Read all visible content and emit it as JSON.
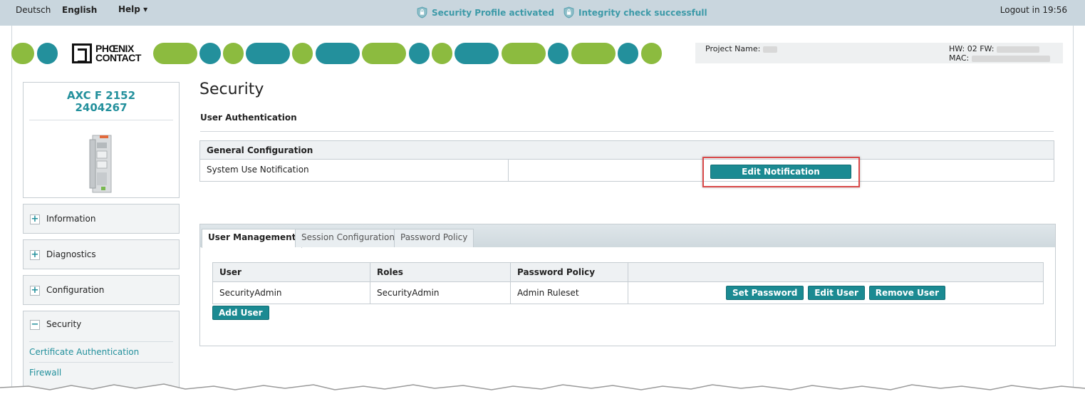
{
  "topbar": {
    "lang_de": "Deutsch",
    "lang_en": "English",
    "help": "Help ▾",
    "status1": "Security Profile activated",
    "status2": "Integrity check successfull",
    "logout": "Logout in 19:56"
  },
  "header": {
    "logo_line1": "PHŒNIX",
    "logo_line2": "CONTACT",
    "project_name_label": "Project Name:",
    "hw_label": "HW: 02 FW:",
    "mac_label": "MAC:"
  },
  "sidebar": {
    "device_name": "AXC F 2152",
    "device_number": "2404267",
    "items": [
      {
        "label": "Information",
        "toggle": "+"
      },
      {
        "label": "Diagnostics",
        "toggle": "+"
      },
      {
        "label": "Configuration",
        "toggle": "+"
      }
    ],
    "security": {
      "label": "Security",
      "toggle": "−",
      "subitems": [
        "Certificate Authentication",
        "Firewall"
      ]
    }
  },
  "main": {
    "title": "Security",
    "section": "User Authentication",
    "general": {
      "header": "General Configuration",
      "row_label": "System Use Notification",
      "button": "Edit Notification"
    },
    "tabs": [
      {
        "label": "User Management",
        "active": true
      },
      {
        "label": "Session Configuration",
        "active": false
      },
      {
        "label": "Password Policy",
        "active": false
      }
    ],
    "user_table": {
      "headers": [
        "User",
        "Roles",
        "Password Policy",
        ""
      ],
      "rows": [
        {
          "user": "SecurityAdmin",
          "roles": "SecurityAdmin",
          "policy": "Admin Ruleset"
        }
      ],
      "actions": [
        "Set Password",
        "Edit User",
        "Remove User"
      ],
      "add_user": "Add User"
    }
  },
  "colors": {
    "accent_teal": "#23909c",
    "accent_green": "#8cbb3f",
    "button": "#1b8a92",
    "highlight": "#d94a4a"
  }
}
